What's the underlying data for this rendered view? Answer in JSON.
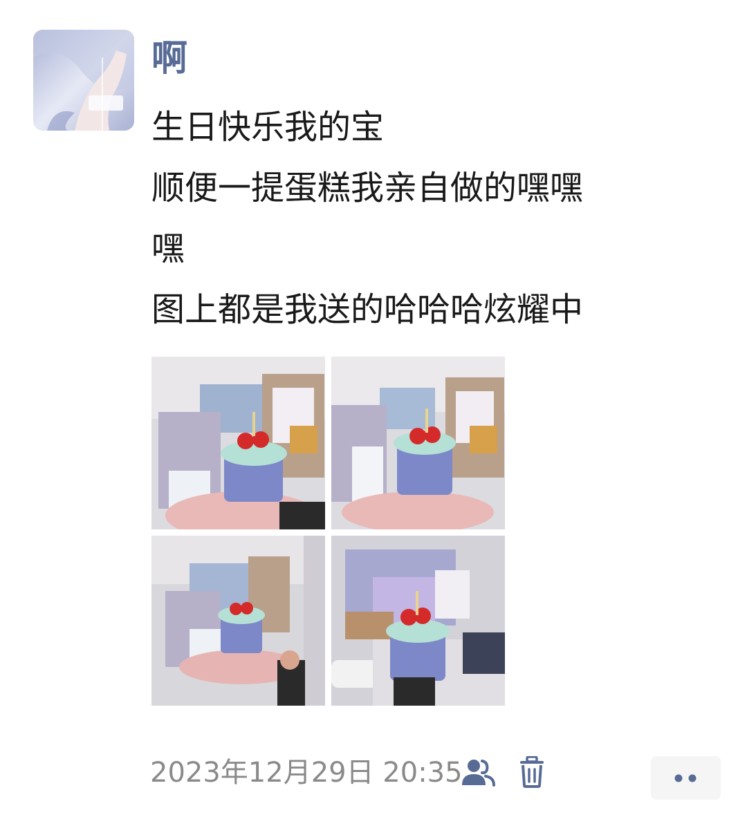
{
  "post": {
    "author": "啊",
    "lines": [
      "生日快乐我的宝",
      "顺便一提蛋糕我亲自做的嘿嘿",
      "嘿",
      "图上都是我送的哈哈哈炫耀中"
    ],
    "photos": [
      {
        "subject": "crocheted-birthday-cake"
      },
      {
        "subject": "crocheted-birthday-cake"
      },
      {
        "subject": "crocheted-birthday-cake"
      },
      {
        "subject": "crocheted-birthday-cake"
      }
    ],
    "timestamp": "2023年12月29日 20:35"
  },
  "icons": {
    "visibility": "friends-icon",
    "delete": "trash-icon",
    "more": "more-dots-icon"
  },
  "colors": {
    "name": "#576b95",
    "text": "#191919",
    "meta": "#8a8a8a",
    "more_bg": "#f5f5f5"
  }
}
